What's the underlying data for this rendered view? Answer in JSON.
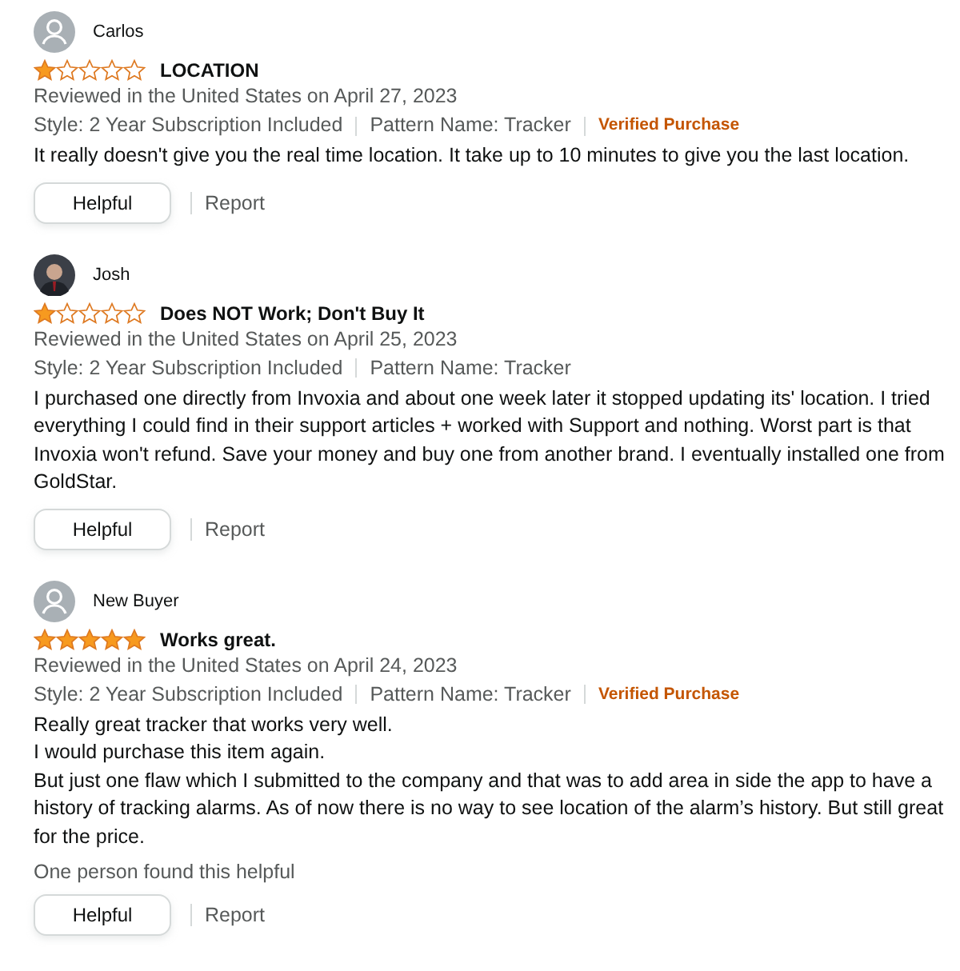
{
  "reviews": [
    {
      "reviewer": "Carlos",
      "avatar_photo": false,
      "stars": 1,
      "title": "LOCATION",
      "date": "Reviewed in the United States on April 27, 2023",
      "style": "Style: 2 Year Subscription Included",
      "pattern": "Pattern Name: Tracker",
      "verified_label": "Verified Purchase",
      "body": [
        "It really doesn't give you the real time location. It take up to 10 minutes to give you the last location."
      ],
      "helpful_button": "Helpful",
      "report_link": "Report"
    },
    {
      "reviewer": "Josh",
      "avatar_photo": true,
      "stars": 1,
      "title": "Does NOT Work; Don't Buy It",
      "date": "Reviewed in the United States on April 25, 2023",
      "style": "Style: 2 Year Subscription Included",
      "pattern": "Pattern Name: Tracker",
      "body": [
        "I purchased one directly from Invoxia and about one week later it stopped updating its' location. I tried everything I could find in their support articles + worked with Support and nothing. Worst part is that Invoxia won't refund. Save your money and buy one from another brand. I eventually installed one from GoldStar."
      ],
      "helpful_button": "Helpful",
      "report_link": "Report"
    },
    {
      "reviewer": "New Buyer",
      "avatar_photo": false,
      "stars": 5,
      "title": "Works great.",
      "date": "Reviewed in the United States on April 24, 2023",
      "style": "Style: 2 Year Subscription Included",
      "pattern": "Pattern Name: Tracker",
      "verified_label": "Verified Purchase",
      "body": [
        "Really great tracker that works very well.",
        "I would purchase this item again.",
        "But just one flaw which I submitted to the company and that was to add area in side the app to have a history of tracking alarms. As of now there is no way to see location of the alarm’s history. But still great for the price."
      ],
      "helpful_count": "One person found this helpful",
      "helpful_button": "Helpful",
      "report_link": "Report"
    }
  ]
}
